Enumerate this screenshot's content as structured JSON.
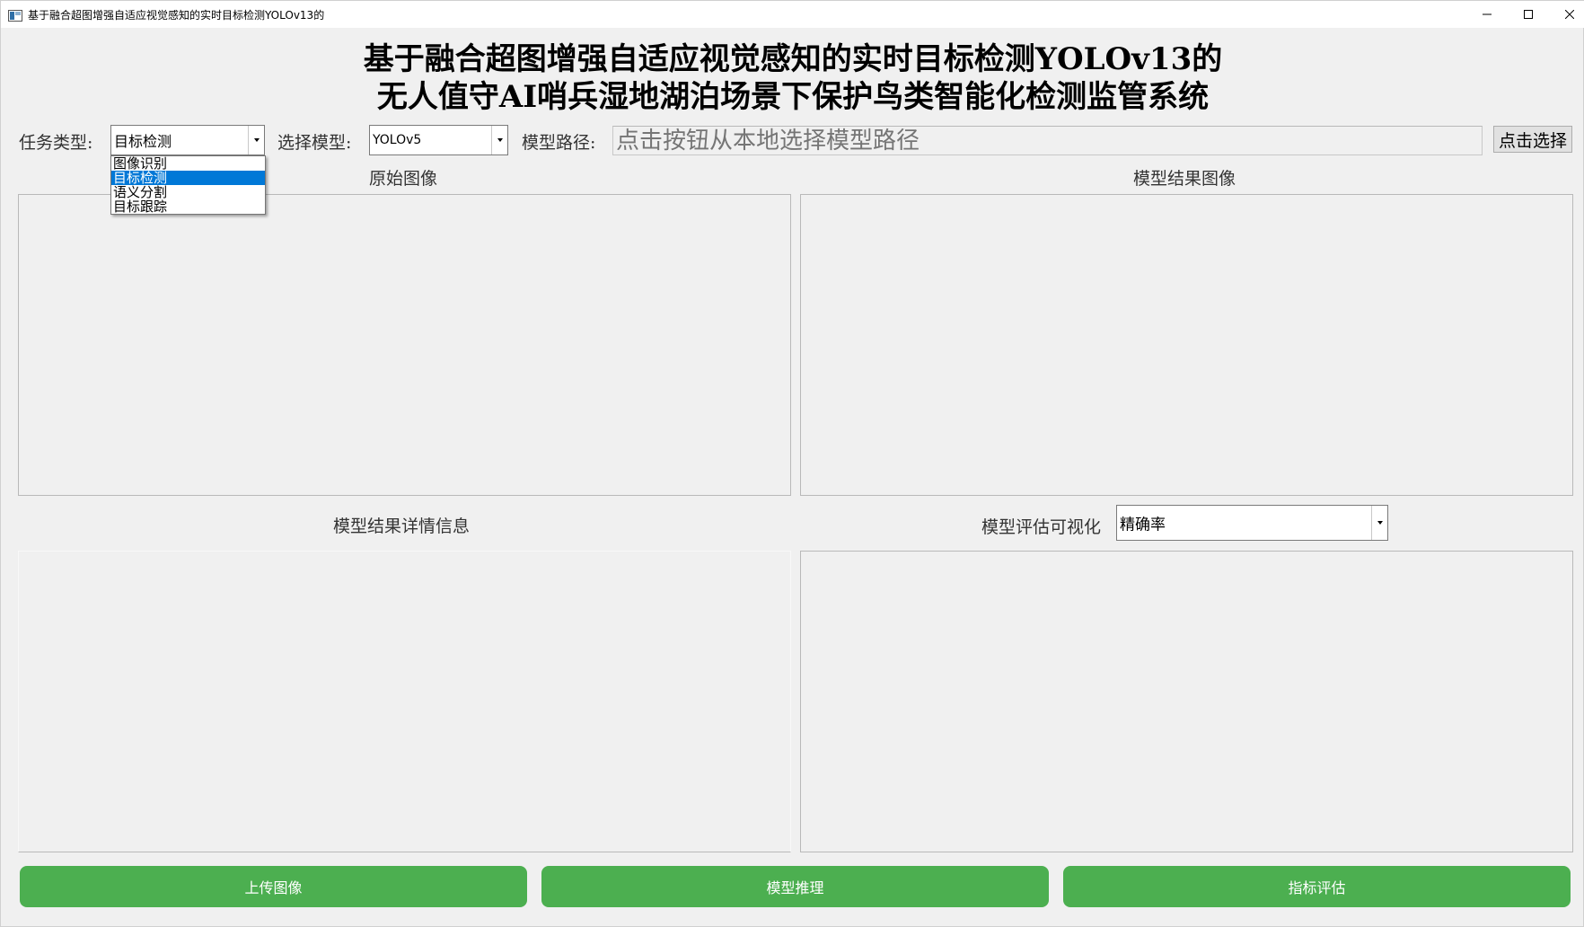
{
  "window": {
    "title": "基于融合超图增强自适应视觉感知的实时目标检测YOLOv13的"
  },
  "heading": {
    "line1": "基于融合超图增强自适应视觉感知的实时目标检测YOLOv13的",
    "line2": "无人值守AI哨兵湿地湖泊场景下保护鸟类智能化检测监管系统"
  },
  "toolbar": {
    "task_label": "任务类型:",
    "task_value": "目标检测",
    "task_options": [
      "图像识别",
      "目标检测",
      "语义分割",
      "目标跟踪"
    ],
    "task_selected_index": 1,
    "model_label": "选择模型:",
    "model_value": "YOLOv5",
    "path_label": "模型路径:",
    "path_placeholder": "点击按钮从本地选择模型路径",
    "select_button": "点击选择"
  },
  "panels": {
    "original_title": "原始图像",
    "result_title": "模型结果图像",
    "details_title": "模型结果详情信息",
    "eval_title": "模型评估可视化",
    "eval_metric": "精确率"
  },
  "actions": {
    "upload": "上传图像",
    "infer": "模型推理",
    "evaluate": "指标评估"
  },
  "colors": {
    "button_green": "#4caf50",
    "selection_blue": "#0078d7"
  }
}
